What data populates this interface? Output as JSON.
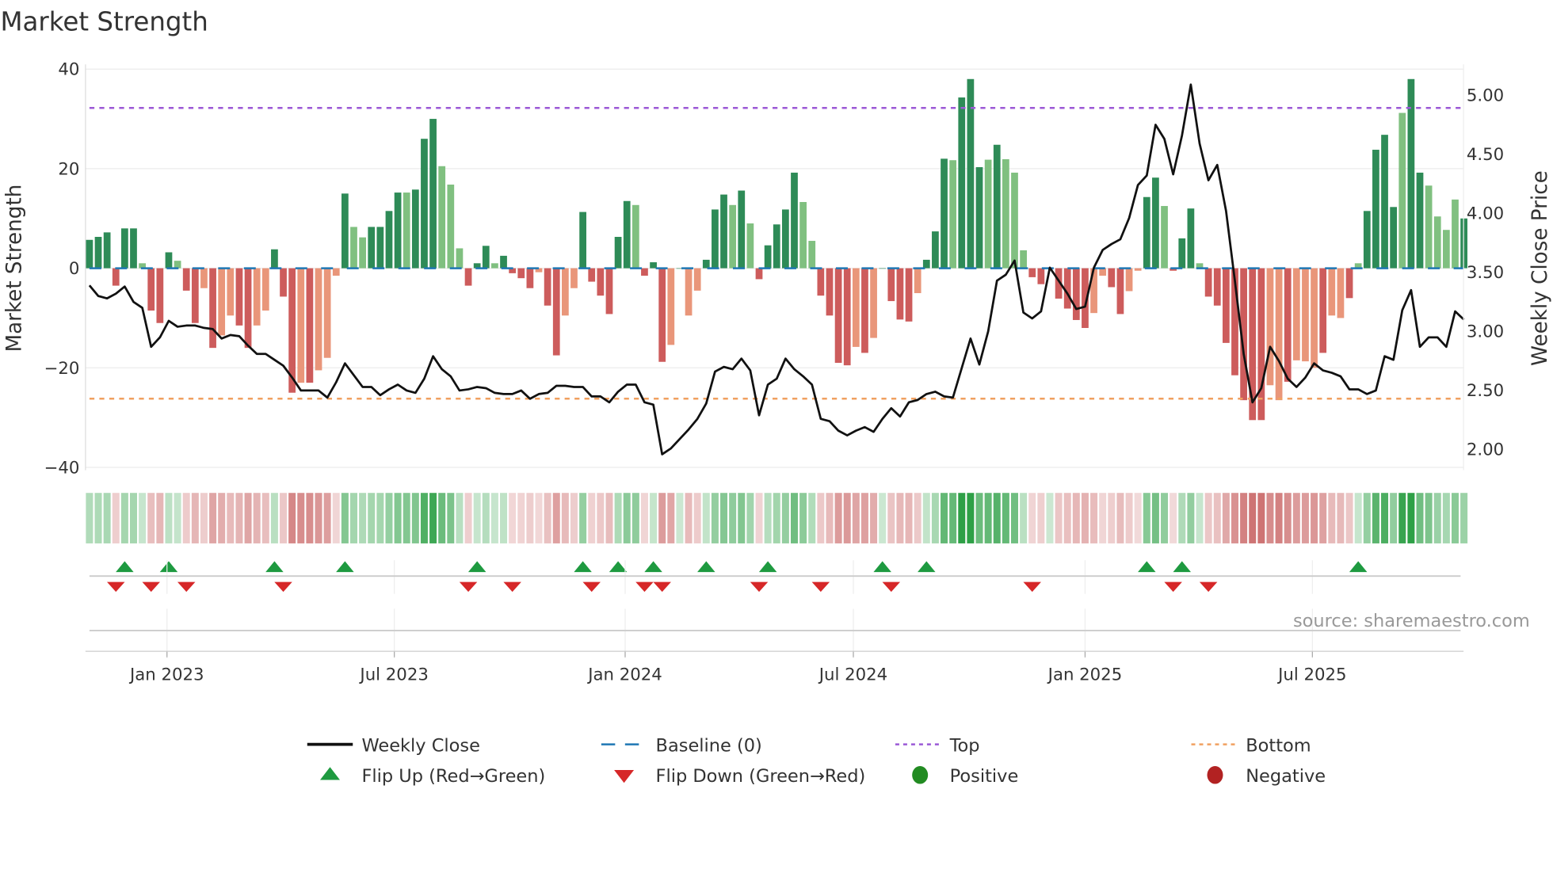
{
  "chart_data": {
    "type": "bar",
    "title": "Market Strength",
    "ylabel": "Market Strength",
    "y2label": "Weekly Close Price",
    "ylim": [
      -40,
      40
    ],
    "y2lim": [
      1.85,
      5.2
    ],
    "yticks": [
      "40",
      "20",
      "0",
      "−20",
      "−40"
    ],
    "ytick_values": [
      40,
      20,
      0,
      -20,
      -40
    ],
    "y2ticks": [
      "5.00",
      "4.50",
      "4.00",
      "3.50",
      "3.00",
      "2.50",
      "2.00"
    ],
    "y2tick_values": [
      5.0,
      4.5,
      4.0,
      3.5,
      3.0,
      2.5,
      2.0
    ],
    "xticks": [
      {
        "label": "Jan 2023",
        "week": 8.8
      },
      {
        "label": "Jul 2023",
        "week": 34.6
      },
      {
        "label": "Jan 2024",
        "week": 60.8
      },
      {
        "label": "Jul 2024",
        "week": 86.7
      },
      {
        "label": "Jan 2025",
        "week": 113
      },
      {
        "label": "Jul 2025",
        "week": 138.8
      }
    ],
    "top_level": 32.2,
    "bottom_level": -26.2,
    "strength": [
      5.7,
      6.3,
      7.2,
      -3.5,
      8,
      8,
      1,
      -8.5,
      -11,
      3.2,
      1.5,
      -4.5,
      -11,
      -4,
      -16,
      -13.5,
      -9.5,
      -11.5,
      -16,
      -11.5,
      -8.5,
      3.8,
      -5.7,
      -25,
      -23,
      -23,
      -20.5,
      -18,
      -1.5,
      15,
      8.3,
      6.2,
      8.3,
      8.3,
      11.5,
      15.2,
      15.2,
      15.8,
      26,
      30,
      20.5,
      16.8,
      4,
      -3.5,
      1,
      4.5,
      1,
      2.5,
      -1,
      -2,
      -4,
      -0.8,
      -7.5,
      -17.5,
      -9.5,
      -4,
      11.3,
      -2.7,
      -5.5,
      -9.2,
      6.3,
      13.5,
      12.7,
      -1.5,
      1.2,
      -18.8,
      -15.4,
      0,
      -9.5,
      -4.5,
      1.7,
      11.8,
      14.8,
      12.7,
      15.6,
      9,
      -2.2,
      4.6,
      8.8,
      11.8,
      19.2,
      13.3,
      5.5,
      -5.5,
      -9.5,
      -19,
      -19.5,
      -15.8,
      -17,
      -14,
      0,
      -6.6,
      -10.3,
      -10.7,
      -5,
      1.7,
      7.4,
      22,
      21.7,
      34.3,
      38,
      20.3,
      21.8,
      24.8,
      21.9,
      19.2,
      3.6,
      -1.8,
      -3.2,
      0,
      -6.1,
      -8.1,
      -10.4,
      -12,
      -9,
      -1.5,
      -3.8,
      -9.2,
      -4.6,
      -0.5,
      14.3,
      18.2,
      12.5,
      -0.5,
      6,
      12,
      1,
      -5.7,
      -7.5,
      -15,
      -21.5,
      -26.5,
      -30.5,
      -30.5,
      -23.5,
      -26.5,
      -22.8,
      -18.5,
      -18.7,
      -20,
      -17,
      -9.5,
      -10,
      -6,
      1,
      11.5,
      23.8,
      26.8,
      12.3,
      31.2,
      38,
      19.2,
      16.6,
      10.4,
      7.7,
      13.8,
      10
    ],
    "strong": "SSSSSSWSSSWSSWSWWSSWWSSSWSWWWSWWSSSSWSSSWWWSSSWSSSSWSSWWSSSSSSWSSSWSWWSSSWSWSSSSSWWSSSSWSWSSSSWSSSWSSSWSWWWSSSSSSSWWSSWWSSWSSSWSSSSSSSWWSWWWSWWSWSSSSWSSWWWWSW",
    "close": [
      3.38,
      3.29,
      3.27,
      3.31,
      3.37,
      3.24,
      3.19,
      2.86,
      2.94,
      3.08,
      3.03,
      3.04,
      3.04,
      3.02,
      3.01,
      2.93,
      2.96,
      2.95,
      2.87,
      2.8,
      2.8,
      2.75,
      2.7,
      2.6,
      2.49,
      2.49,
      2.49,
      2.43,
      2.56,
      2.72,
      2.62,
      2.52,
      2.52,
      2.45,
      2.5,
      2.54,
      2.49,
      2.47,
      2.59,
      2.78,
      2.67,
      2.61,
      2.49,
      2.5,
      2.52,
      2.51,
      2.47,
      2.46,
      2.46,
      2.49,
      2.42,
      2.46,
      2.47,
      2.53,
      2.53,
      2.52,
      2.52,
      2.44,
      2.44,
      2.39,
      2.48,
      2.54,
      2.54,
      2.39,
      2.37,
      1.95,
      2.0,
      2.08,
      2.16,
      2.25,
      2.38,
      2.65,
      2.69,
      2.67,
      2.76,
      2.66,
      2.28,
      2.54,
      2.59,
      2.76,
      2.67,
      2.61,
      2.54,
      2.25,
      2.23,
      2.15,
      2.11,
      2.15,
      2.18,
      2.14,
      2.25,
      2.34,
      2.27,
      2.39,
      2.41,
      2.46,
      2.48,
      2.44,
      2.43,
      2.68,
      2.93,
      2.71,
      2.99,
      3.42,
      3.47,
      3.59,
      3.15,
      3.1,
      3.16,
      3.53,
      3.42,
      3.31,
      3.18,
      3.2,
      3.53,
      3.68,
      3.73,
      3.77,
      3.95,
      4.23,
      4.31,
      4.74,
      4.62,
      4.32,
      4.65,
      5.08,
      4.58,
      4.27,
      4.4,
      4.01,
      3.42,
      2.8,
      2.39,
      2.51,
      2.86,
      2.74,
      2.59,
      2.52,
      2.6,
      2.72,
      2.66,
      2.64,
      2.61,
      2.5,
      2.5,
      2.46,
      2.49,
      2.78,
      2.75,
      3.17,
      3.34,
      2.86,
      2.94,
      2.94,
      2.86,
      3.16,
      3.09
    ],
    "flip_up_weeks": [
      4,
      9,
      21,
      29,
      44,
      56,
      60,
      64,
      70,
      77,
      90,
      95,
      120,
      124,
      144
    ],
    "flip_down_weeks": [
      3,
      7,
      11,
      22,
      43,
      48,
      57,
      63,
      65,
      76,
      83,
      91,
      107,
      123,
      127
    ],
    "legend": {
      "placement": "bottom",
      "items": [
        {
          "label": "Weekly Close"
        },
        {
          "label": "Baseline (0)"
        },
        {
          "label": "Top"
        },
        {
          "label": "Bottom"
        },
        {
          "label": "Flip Up (Red→Green)"
        },
        {
          "label": "Flip Down (Green→Red)"
        },
        {
          "label": "Positive"
        },
        {
          "label": "Negative"
        }
      ]
    },
    "source": "source: sharemaestro.com"
  },
  "colors": {
    "pos_strong": "#2e8b57",
    "pos_weak": "#80c080",
    "neg_strong": "#cd5c5c",
    "neg_weak": "#e9967a",
    "baseline": "#1f77b4",
    "top": "#9b59d6",
    "bottom": "#f0a060",
    "flip_up": "#1e9a40",
    "flip_down": "#d62728",
    "positive": "#228b22",
    "negative": "#b22222",
    "close": "#111111"
  }
}
